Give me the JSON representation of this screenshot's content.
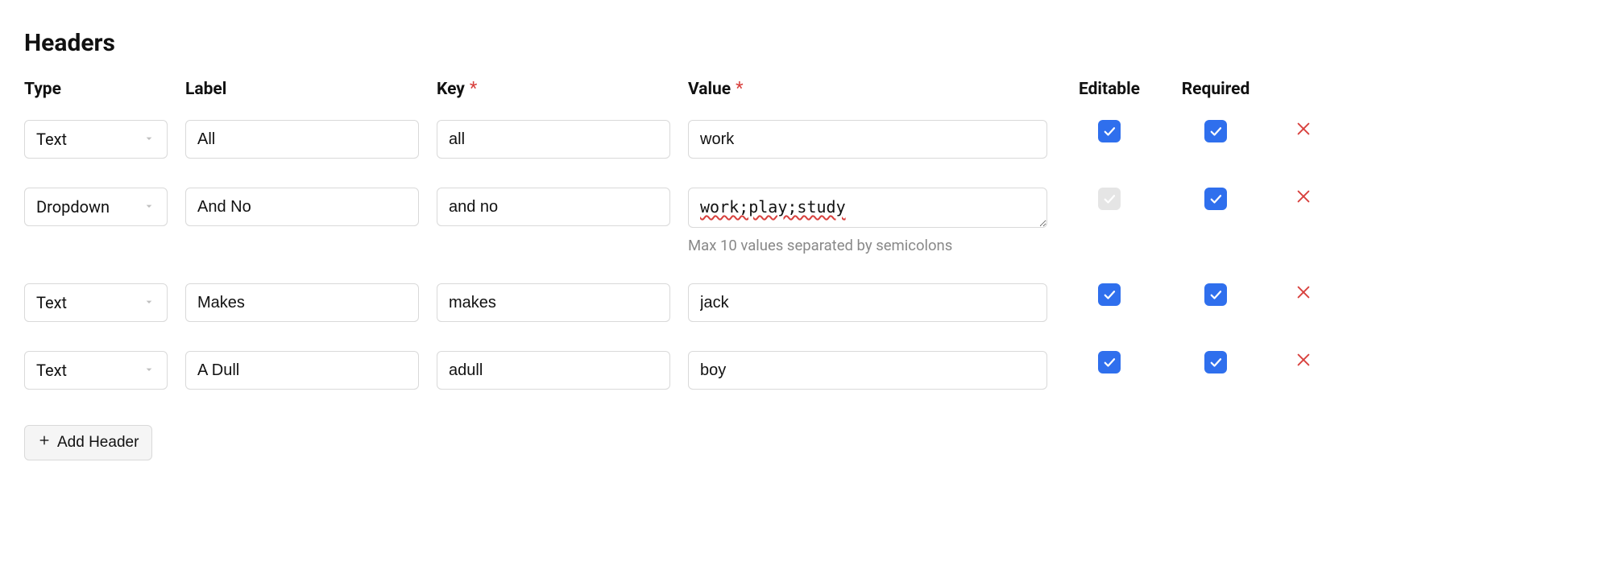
{
  "section": {
    "title": "Headers"
  },
  "columns": {
    "type": "Type",
    "label": "Label",
    "key": "Key",
    "value": "Value",
    "editable": "Editable",
    "required": "Required"
  },
  "rows": [
    {
      "type": "Text",
      "label": "All",
      "key": "all",
      "value": "work",
      "value_kind": "text",
      "editable": "checked",
      "required": "checked"
    },
    {
      "type": "Dropdown",
      "label": "And No",
      "key": "and no",
      "value": "work;play;study",
      "value_kind": "textarea",
      "helper": "Max 10 values separated by semicolons",
      "editable": "disabled-checked",
      "required": "checked"
    },
    {
      "type": "Text",
      "label": "Makes",
      "key": "makes",
      "value": "jack",
      "value_kind": "text",
      "editable": "checked",
      "required": "checked"
    },
    {
      "type": "Text",
      "label": "A Dull",
      "key": "adull",
      "value": "boy",
      "value_kind": "text",
      "editable": "checked",
      "required": "checked"
    }
  ],
  "add_button": {
    "label": "Add Header"
  }
}
